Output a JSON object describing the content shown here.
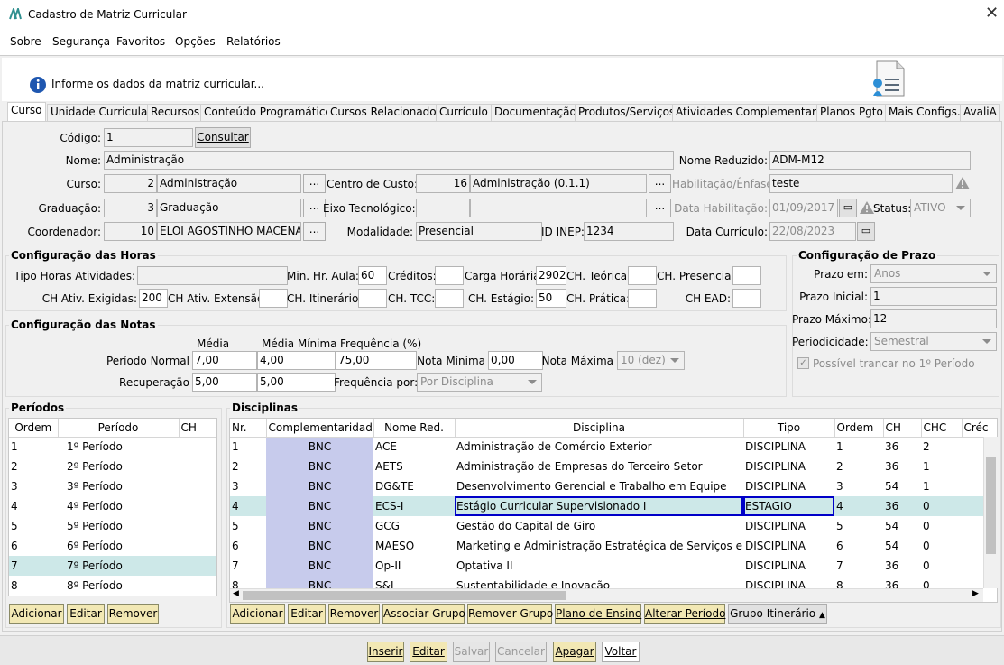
{
  "window": {
    "title": "Cadastro de Matriz Curricular"
  },
  "menu": [
    "Sobre",
    "Segurança",
    "Favoritos",
    "Opções",
    "Relatórios"
  ],
  "info": "Informe os dados da matriz curricular...",
  "tabs": [
    "Curso",
    "Unidade Curricular",
    "Recursos",
    "Conteúdo Programático",
    "Cursos Relacionados",
    "Currículo",
    "Documentação",
    "Produtos/Serviços",
    "Atividades Complementares",
    "Planos Pgto",
    "Mais Configs.",
    "AvaliA"
  ],
  "curso": {
    "codigo_label": "Código:",
    "codigo": "1",
    "consultar": "Consultar",
    "nome_label": "Nome:",
    "nome": "Administração",
    "nome_reduzido_label": "Nome Reduzido:",
    "nome_reduzido": "ADM-M12",
    "curso_label": "Curso:",
    "curso_code": "2",
    "curso_name": "Administração",
    "centro_label": "Centro de Custo:",
    "centro_code": "16",
    "centro_name": "Administração (0.1.1)",
    "habilitacao_label": "Habilitação/Ênfase:",
    "habilitacao": "teste",
    "graduacao_label": "Graduação:",
    "graduacao_code": "3",
    "graduacao_name": "Graduação",
    "eixo_label": "Eixo Tecnológico:",
    "data_hab_label": "Data Habilitação:",
    "data_hab": "01/09/2017",
    "status_label": "Status:",
    "status": "ATIVO",
    "coord_label": "Coordenador:",
    "coord_code": "10",
    "coord_name": "ELOI AGOSTINHO MACENA",
    "modalidade_label": "Modalidade:",
    "modalidade": "Presencial",
    "inep_label": "ID INEP:",
    "inep": "1234",
    "data_curr_label": "Data Currículo:",
    "data_curr": "22/08/2023",
    "dots": "..."
  },
  "horas": {
    "title": "Configuração das Horas",
    "tipo_label": "Tipo Horas Atividades:",
    "min_label": "Min. Hr. Aula:",
    "min": "60",
    "creditos_label": "Créditos:",
    "carga_label": "Carga Horária:",
    "carga": "2902",
    "teorica_label": "CH. Teórica:",
    "presencial_label": "CH. Presencial:",
    "exigidas_label": "CH Ativ. Exigidas:",
    "exigidas": "200",
    "extensao_label": "CH Ativ. Extensão:",
    "itinerario_label": "CH. Itinerário:",
    "tcc_label": "CH. TCC:",
    "estagio_label": "CH. Estágio:",
    "estagio": "50",
    "pratica_label": "CH. Prática:",
    "ead_label": "CH EAD:"
  },
  "notas": {
    "title": "Configuração das Notas",
    "media_h": "Média",
    "media_min_h": "Média Mínima",
    "freq_h": "Frequência (%)",
    "periodo_label": "Período Normal",
    "p_media": "7,00",
    "p_min": "4,00",
    "p_freq": "75,00",
    "nota_min_label": "Nota Mínima",
    "nota_min": "0,00",
    "nota_max_label": "Nota Máxima",
    "nota_max": "10 (dez)",
    "rec_label": "Recuperação",
    "r_media": "5,00",
    "r_min": "5,00",
    "freq_por_label": "Frequência por:",
    "freq_por": "Por Disciplina"
  },
  "prazo": {
    "title": "Configuração de Prazo",
    "prazo_em_label": "Prazo em:",
    "prazo_em": "Anos",
    "inicial_label": "Prazo Inicial:",
    "inicial": "1",
    "maximo_label": "Prazo Máximo:",
    "maximo": "12",
    "period_label": "Periodicidade:",
    "period": "Semestral",
    "trancar": "Possível trancar no 1º Período"
  },
  "periodos": {
    "title": "Períodos",
    "headers": [
      "Ordem",
      "Período",
      "CH"
    ],
    "rows": [
      [
        "1",
        "1º Período"
      ],
      [
        "2",
        "2º Período"
      ],
      [
        "3",
        "3º Período"
      ],
      [
        "4",
        "4º Período"
      ],
      [
        "5",
        "5º Período"
      ],
      [
        "6",
        "6º Período"
      ],
      [
        "7",
        "7º Período"
      ],
      [
        "8",
        "8º Período"
      ]
    ],
    "buttons": [
      "Adicionar",
      "Editar",
      "Remover"
    ]
  },
  "disciplinas": {
    "title": "Disciplinas",
    "headers": [
      "Nr.",
      "Complementaridade",
      "Nome Red.",
      "Disciplina",
      "Tipo",
      "Ordem",
      "CH",
      "CHC",
      "Créc"
    ],
    "rows": [
      [
        "1",
        "BNC",
        "ACE",
        "Administração de Comércio Exterior",
        "DISCIPLINA",
        "1",
        "36",
        "2"
      ],
      [
        "2",
        "BNC",
        "AETS",
        "Administração de Empresas do Terceiro Setor",
        "DISCIPLINA",
        "2",
        "36",
        "1"
      ],
      [
        "3",
        "BNC",
        "DG&TE",
        "Desenvolvimento Gerencial e Trabalho em Equipe",
        "DISCIPLINA",
        "3",
        "54",
        "1"
      ],
      [
        "4",
        "BNC",
        "ECS-I",
        "Estágio Curricular Supervisionado I",
        "ESTAGIO",
        "4",
        "36",
        "0"
      ],
      [
        "5",
        "BNC",
        "GCG",
        "Gestão do Capital de Giro",
        "DISCIPLINA",
        "5",
        "54",
        "0"
      ],
      [
        "6",
        "BNC",
        "MAESO",
        "Marketing e Administração Estratégica de Serviços e Operações",
        "DISCIPLINA",
        "6",
        "54",
        "0"
      ],
      [
        "7",
        "BNC",
        "Op-II",
        "Optativa II",
        "DISCIPLINA",
        "7",
        "36",
        "0"
      ],
      [
        "8",
        "BNC",
        "S&I",
        "Sustentabilidade e Inovação",
        "DISCIPLINA",
        "8",
        "36",
        "0"
      ]
    ],
    "buttons": [
      "Adicionar",
      "Editar",
      "Remover",
      "Associar Grupo",
      "Remover Grupo",
      "Plano de Ensino",
      "Alterar Período"
    ],
    "grupo": "Grupo Itinerário"
  },
  "footer": [
    "Inserir",
    "Editar",
    "Salvar",
    "Cancelar",
    "Apagar",
    "Voltar"
  ]
}
